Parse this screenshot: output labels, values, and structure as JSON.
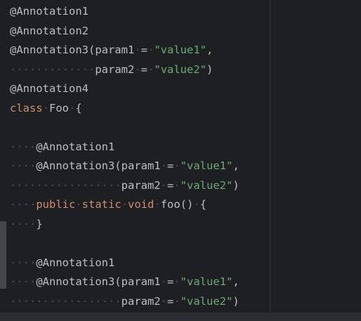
{
  "editor": {
    "lines": [
      [
        {
          "cls": "ann",
          "text": "@Annotation1"
        }
      ],
      [
        {
          "cls": "ann",
          "text": "@Annotation2"
        }
      ],
      [
        {
          "cls": "ann",
          "text": "@Annotation3(param1"
        },
        {
          "cls": "ws",
          "text": "·"
        },
        {
          "cls": "plain",
          "text": "="
        },
        {
          "cls": "ws",
          "text": "·"
        },
        {
          "cls": "str",
          "text": "\"value1\""
        },
        {
          "cls": "plain",
          "text": ","
        }
      ],
      [
        {
          "cls": "ws",
          "text": "·············"
        },
        {
          "cls": "plain",
          "text": "param2"
        },
        {
          "cls": "ws",
          "text": "·"
        },
        {
          "cls": "plain",
          "text": "="
        },
        {
          "cls": "ws",
          "text": "·"
        },
        {
          "cls": "str",
          "text": "\"value2\""
        },
        {
          "cls": "plain",
          "text": ")"
        }
      ],
      [
        {
          "cls": "ann",
          "text": "@Annotation4"
        }
      ],
      [
        {
          "cls": "kw",
          "text": "class"
        },
        {
          "cls": "ws",
          "text": "·"
        },
        {
          "cls": "plain",
          "text": "Foo"
        },
        {
          "cls": "ws",
          "text": "·"
        },
        {
          "cls": "plain",
          "text": "{"
        }
      ],
      [
        {
          "cls": "plain",
          "text": ""
        }
      ],
      [
        {
          "cls": "ws",
          "text": "····"
        },
        {
          "cls": "ann",
          "text": "@Annotation1"
        }
      ],
      [
        {
          "cls": "ws",
          "text": "····"
        },
        {
          "cls": "ann",
          "text": "@Annotation3(param1"
        },
        {
          "cls": "ws",
          "text": "·"
        },
        {
          "cls": "plain",
          "text": "="
        },
        {
          "cls": "ws",
          "text": "·"
        },
        {
          "cls": "str",
          "text": "\"value1\""
        },
        {
          "cls": "plain",
          "text": ","
        }
      ],
      [
        {
          "cls": "ws",
          "text": "·················"
        },
        {
          "cls": "plain",
          "text": "param2"
        },
        {
          "cls": "ws",
          "text": "·"
        },
        {
          "cls": "plain",
          "text": "="
        },
        {
          "cls": "ws",
          "text": "·"
        },
        {
          "cls": "str",
          "text": "\"value2\""
        },
        {
          "cls": "plain",
          "text": ")"
        }
      ],
      [
        {
          "cls": "ws",
          "text": "····"
        },
        {
          "cls": "kw",
          "text": "public"
        },
        {
          "cls": "ws",
          "text": "·"
        },
        {
          "cls": "kw",
          "text": "static"
        },
        {
          "cls": "ws",
          "text": "·"
        },
        {
          "cls": "kw",
          "text": "void"
        },
        {
          "cls": "ws",
          "text": "·"
        },
        {
          "cls": "plain",
          "text": "foo()"
        },
        {
          "cls": "ws",
          "text": "·"
        },
        {
          "cls": "plain",
          "text": "{"
        }
      ],
      [
        {
          "cls": "ws",
          "text": "····"
        },
        {
          "cls": "plain",
          "text": "}"
        }
      ],
      [
        {
          "cls": "plain",
          "text": ""
        }
      ],
      [
        {
          "cls": "ws",
          "text": "····"
        },
        {
          "cls": "ann",
          "text": "@Annotation1"
        }
      ],
      [
        {
          "cls": "ws",
          "text": "····"
        },
        {
          "cls": "ann",
          "text": "@Annotation3(param1"
        },
        {
          "cls": "ws",
          "text": "·"
        },
        {
          "cls": "plain",
          "text": "="
        },
        {
          "cls": "ws",
          "text": "·"
        },
        {
          "cls": "str",
          "text": "\"value1\""
        },
        {
          "cls": "plain",
          "text": ","
        }
      ],
      [
        {
          "cls": "ws",
          "text": "·················"
        },
        {
          "cls": "plain",
          "text": "param2"
        },
        {
          "cls": "ws",
          "text": "·"
        },
        {
          "cls": "plain",
          "text": "="
        },
        {
          "cls": "ws",
          "text": "·"
        },
        {
          "cls": "str",
          "text": "\"value2\""
        },
        {
          "cls": "plain",
          "text": ")"
        }
      ]
    ]
  },
  "colors": {
    "background": "#1e1f22",
    "keyword": "#cf8e6d",
    "string": "#6aab73",
    "text": "#bcbec4",
    "whitespace": "#4b4d52"
  }
}
